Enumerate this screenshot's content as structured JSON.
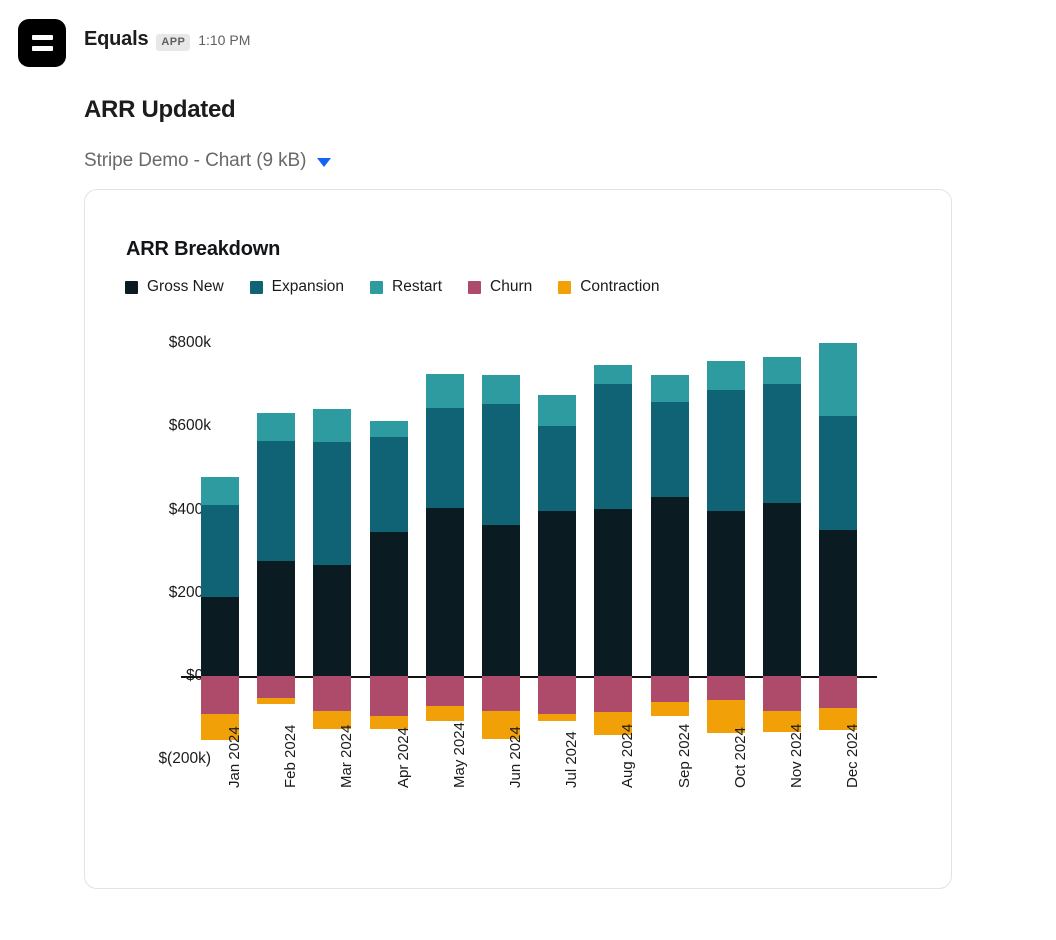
{
  "message": {
    "sender": "Equals",
    "app_badge": "APP",
    "timestamp": "1:10 PM",
    "title": "ARR Updated",
    "file_name": "Stripe Demo - Chart (9 kB)",
    "avatar_icon": "equals-app-icon",
    "caret_icon": "chevron-down-icon"
  },
  "chart_data": {
    "type": "bar",
    "stacked": true,
    "title": "ARR Breakdown",
    "xlabel": "",
    "ylabel": "",
    "grid": false,
    "legend_position": "top-left",
    "ylim": [
      -200,
      880
    ],
    "yticks": [
      800,
      600,
      400,
      200,
      0,
      -200
    ],
    "ytick_labels": [
      "$800k",
      "$600k",
      "$400k",
      "$200k",
      "$0k",
      "$(200k)"
    ],
    "categories": [
      "Jan 2024",
      "Feb 2024",
      "Mar 2024",
      "Apr 2024",
      "May 2024",
      "Jun 2024",
      "Jul 2024",
      "Aug 2024",
      "Sep 2024",
      "Oct 2024",
      "Nov 2024",
      "Dec 2024"
    ],
    "series": [
      {
        "name": "Gross New",
        "color": "#0b1b22",
        "values": [
          190,
          277,
          266,
          345,
          404,
          363,
          397,
          401,
          431,
          397,
          415,
          351
        ]
      },
      {
        "name": "Expansion",
        "color": "#0f6375",
        "values": [
          222,
          288,
          297,
          228,
          240,
          291,
          203,
          301,
          228,
          290,
          286,
          274
        ]
      },
      {
        "name": "Restart",
        "color": "#2e9ba1",
        "values": [
          66,
          68,
          78,
          40,
          81,
          69,
          74,
          44,
          63,
          69,
          65,
          176
        ]
      },
      {
        "name": "Churn",
        "color": "#ae4b6b",
        "values": [
          -91,
          -53,
          -83,
          -95,
          -71,
          -84,
          -91,
          -86,
          -62,
          -58,
          -85,
          -77
        ]
      },
      {
        "name": "Contraction",
        "color": "#f2a007",
        "values": [
          -62,
          -15,
          -45,
          -32,
          -36,
          -68,
          -17,
          -55,
          -35,
          -79,
          -50,
          -52
        ]
      }
    ]
  }
}
